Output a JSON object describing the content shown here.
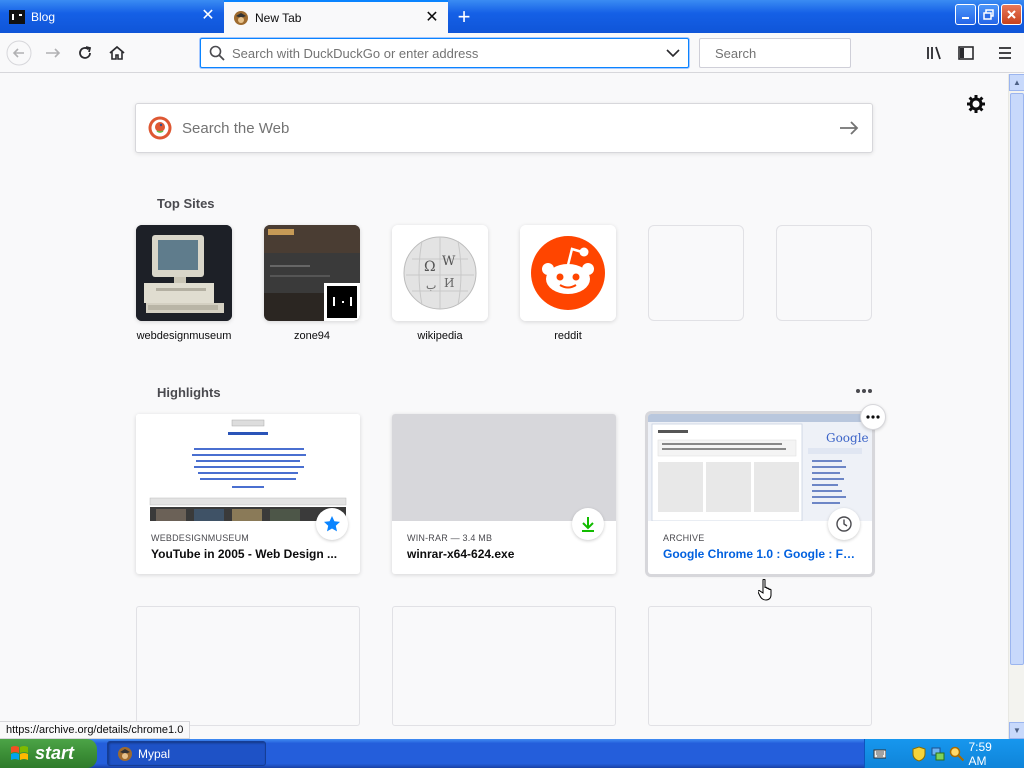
{
  "tabs": [
    {
      "label": "Blog",
      "active": false,
      "favicon": "blog-favicon"
    },
    {
      "label": "New Tab",
      "active": true,
      "favicon": "firefox-favicon"
    }
  ],
  "toolbar": {
    "url_placeholder": "Search with DuckDuckGo or enter address",
    "search_placeholder": "Search"
  },
  "newtab": {
    "websearch_placeholder": "Search the Web",
    "top_sites_title": "Top Sites",
    "top_sites": [
      {
        "label": "webdesignmuseum"
      },
      {
        "label": "zone94"
      },
      {
        "label": "wikipedia"
      },
      {
        "label": "reddit"
      },
      {
        "label": ""
      },
      {
        "label": ""
      }
    ],
    "highlights_title": "Highlights",
    "highlights": [
      {
        "context": "WEBDESIGNMUSEUM",
        "title": "YouTube in 2005 - Web Design ...",
        "badge": "bookmark-star-icon"
      },
      {
        "context": "WIN-RAR — 3.4 MB",
        "title": "winrar-x64-624.exe",
        "badge": "download-icon"
      },
      {
        "context": "ARCHIVE",
        "title": "Google Chrome 1.0 : Google : Fr...",
        "badge": "history-clock-icon"
      }
    ]
  },
  "status_url": "https://archive.org/details/chrome1.0",
  "taskbar": {
    "start_label": "start",
    "task_label": "Mypal",
    "clock": "7:59 AM"
  },
  "colors": {
    "accent": "#0a84ff",
    "xp_blue": "#245edb",
    "reddit": "#ff4500"
  }
}
